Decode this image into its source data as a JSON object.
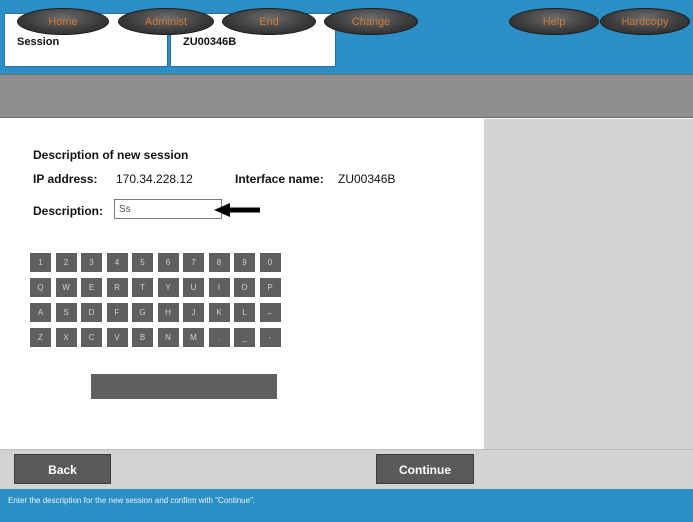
{
  "header": {
    "session_label": "Session",
    "interface_id": "ZU00346B"
  },
  "nav": {
    "home": "Home",
    "admin": "Administ",
    "end": "End",
    "change": "Change",
    "help": "Help",
    "hardcopy": "Hardcopy"
  },
  "form": {
    "title": "Description of new session",
    "ip_label": "IP address:",
    "ip_value": "170.34.228.12",
    "interface_label": "Interface name:",
    "interface_value": "ZU00346B",
    "description_label": "Description:",
    "description_value": "Ss"
  },
  "keyboard": {
    "row1": [
      "1",
      "2",
      "3",
      "4",
      "5",
      "6",
      "7",
      "8",
      "9",
      "0"
    ],
    "row2": [
      "Q",
      "W",
      "E",
      "R",
      "T",
      "Y",
      "U",
      "I",
      "O",
      "P"
    ],
    "row3": [
      "A",
      "S",
      "D",
      "F",
      "G",
      "H",
      "J",
      "K",
      "L",
      "←"
    ],
    "row4": [
      "Z",
      "X",
      "C",
      "V",
      "B",
      "N",
      "M",
      ".",
      "_",
      "-"
    ]
  },
  "footer": {
    "back": "Back",
    "continue": "Continue",
    "status": "Enter the description for the new session and confirm with \"Continue\"."
  },
  "colors": {
    "header_blue": "#2b8fc6",
    "nav_gray": "#8e8e8e",
    "nav_text": "#cf7b3a",
    "panel_gray": "#d3d3d3",
    "key_gray": "#5f5f5f"
  }
}
